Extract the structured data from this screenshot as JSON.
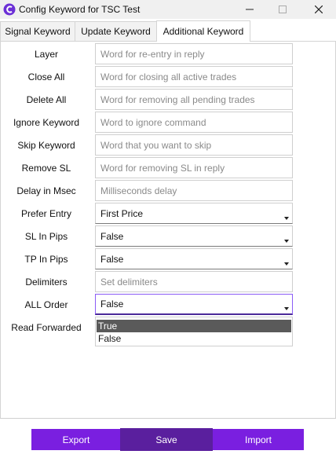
{
  "window": {
    "title": "Config Keyword for TSC Test",
    "minimize_icon": "minimize-icon",
    "maximize_icon": "maximize-icon",
    "close_icon": "close-icon"
  },
  "tabs": [
    {
      "label": "Signal Keyword"
    },
    {
      "label": "Update Keyword"
    },
    {
      "label": "Additional Keyword",
      "active": true
    }
  ],
  "form": {
    "layer": {
      "label": "Layer",
      "placeholder": "Word for re-entry in reply"
    },
    "close_all": {
      "label": "Close All",
      "placeholder": "Word for closing all active trades"
    },
    "delete_all": {
      "label": "Delete All",
      "placeholder": "Word for removing all pending trades"
    },
    "ignore_keyword": {
      "label": "Ignore Keyword",
      "placeholder": "Word to ignore command"
    },
    "skip_keyword": {
      "label": "Skip Keyword",
      "placeholder": "Word that you want to skip"
    },
    "remove_sl": {
      "label": "Remove SL",
      "placeholder": "Word for removing SL in reply"
    },
    "delay": {
      "label": "Delay in Msec",
      "placeholder": "Milliseconds delay"
    },
    "prefer_entry": {
      "label": "Prefer Entry",
      "value": "First Price"
    },
    "sl_in_pips": {
      "label": "SL In Pips",
      "value": "False"
    },
    "tp_in_pips": {
      "label": "TP In Pips",
      "value": "False"
    },
    "delimiters": {
      "label": "Delimiters",
      "placeholder": "Set delimiters"
    },
    "all_order": {
      "label": "ALL Order",
      "value": "False"
    },
    "read_forwarded": {
      "label": "Read Forwarded"
    }
  },
  "dropdown": {
    "options": [
      "True",
      "False"
    ],
    "highlighted": "True"
  },
  "footer": {
    "export_label": "Export",
    "save_label": "Save",
    "import_label": "Import"
  },
  "colors": {
    "accent": "#7a1fe0",
    "accent_dark": "#5a1f9e"
  }
}
